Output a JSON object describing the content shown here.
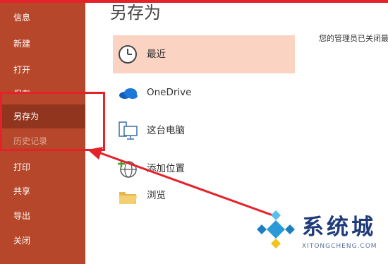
{
  "colors": {
    "sidebar": "#b7472a",
    "sidebar_selected": "#92351e",
    "location_selected": "#fbd3c2",
    "annotation": "#e5212a"
  },
  "sidebar": {
    "items": [
      {
        "label": "信息"
      },
      {
        "label": "新建"
      },
      {
        "label": "打开"
      },
      {
        "label": "保存"
      },
      {
        "label": "另存为"
      },
      {
        "label": "历史记录"
      },
      {
        "label": "打印"
      },
      {
        "label": "共享"
      },
      {
        "label": "导出"
      },
      {
        "label": "关闭"
      }
    ],
    "selected": "另存为"
  },
  "main": {
    "title": "另存为",
    "locations": [
      {
        "label": "最近",
        "icon": "clock-icon"
      },
      {
        "label": "OneDrive",
        "icon": "cloud-icon"
      },
      {
        "label": "这台电脑",
        "icon": "computer-icon"
      },
      {
        "label": "添加位置",
        "icon": "globe-add-icon"
      },
      {
        "label": "浏览",
        "icon": "folder-icon"
      }
    ],
    "selected": "最近"
  },
  "right_pane": {
    "notice": "您的管理员已关闭最"
  },
  "watermark": {
    "title": "系统城",
    "subtitle": "XITONGCHENG.COM"
  }
}
